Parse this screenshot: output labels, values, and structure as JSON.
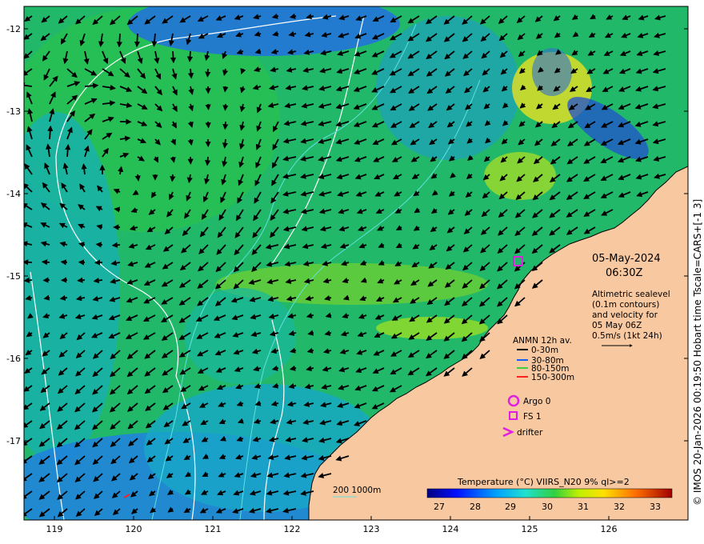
{
  "map": {
    "date": "05-May-2024",
    "time": "06:30Z",
    "credit": "© IMOS 20-Jan-2026 00:19:50 Hobart time Tscale=CARS+[-1 3]",
    "info_lines": [
      "Altimetric sealevel",
      "(0.1m contours)",
      "and velocity for",
      "05 May 06Z",
      "0.5m/s (1kt 24h)"
    ],
    "lon_ticks": [
      "119",
      "120",
      "121",
      "122",
      "123",
      "124",
      "125",
      "126"
    ],
    "lat_ticks": [
      "-12",
      "-13",
      "-14",
      "-15",
      "-16",
      "-17"
    ],
    "lon_range": [
      118.6,
      127.0
    ],
    "lat_range": [
      -11.7,
      -17.8
    ],
    "bathymetry_label": "200  1000m",
    "colors": {
      "land": "#f8c8a0",
      "ocean_warm": "#20c060",
      "ocean_cool": "#1f8fe0",
      "contour": "#ffffff",
      "bathymetry": "#60e0e0",
      "marker": "#e020e0"
    }
  },
  "legend": {
    "title": "ANMN 12h av.",
    "items": [
      {
        "label": "0-30m",
        "color": "#000000"
      },
      {
        "label": "30-80m",
        "color": "#1060ff"
      },
      {
        "label": "80-150m",
        "color": "#40d040"
      },
      {
        "label": "150-300m",
        "color": "#ff2020"
      }
    ],
    "platforms": [
      {
        "label": "Argo 0",
        "symbol": "circle"
      },
      {
        "label": "FS 1",
        "symbol": "square"
      },
      {
        "label": "drifter",
        "symbol": "chevron"
      }
    ]
  },
  "colorbar": {
    "title": "Temperature (°C) VIIRS_N20 9% ql>=2",
    "ticks": [
      "27",
      "28",
      "29",
      "30",
      "31",
      "32",
      "33"
    ],
    "range": [
      26.5,
      33.5
    ]
  }
}
